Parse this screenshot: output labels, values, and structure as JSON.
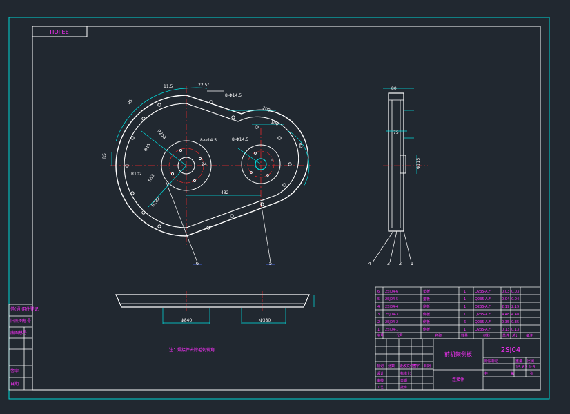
{
  "colors": {
    "background": "#212830",
    "frame": "#00d6d6",
    "geometry": "#ffffff",
    "dimension": "#00e5e5",
    "centerline": "#ff2a2a",
    "text_magenta": "#ff30ff",
    "leader_blue": "#4a6cff"
  },
  "drawing": {
    "top_left_tag": "ПОГЕЕ",
    "code": "2SJ04",
    "part_name": "前机架侧板",
    "note": "注：焊接件去除毛刺锐角",
    "dimensions": {
      "d0": "11.5",
      "d1": "22.5°",
      "d2": "R5",
      "d3": "8-Φ14.5",
      "d4": "200",
      "d5": "100",
      "d6": "R2",
      "d7": "R5",
      "d8": "R253",
      "d9": "Φ15",
      "d10": "R102",
      "d11": "R282",
      "d12": "432",
      "d13": "8-Φ14.5",
      "d14": "8-Φ14.5",
      "d15": "24",
      "d16": "R53",
      "d17": "Φ840",
      "d18": "Φ380",
      "d19": "75",
      "d20": "Φ115",
      "d21": "80"
    },
    "balloons_front": [
      "6",
      "5"
    ],
    "balloons_side": [
      "4",
      "3",
      "2",
      "1"
    ],
    "bom_rows": [
      {
        "no": "6",
        "code": "2SJ04-6",
        "name": "垫板",
        "qty": "1",
        "material": "Q235-A.F",
        "unit": "0.03",
        "total": "0.03"
      },
      {
        "no": "5",
        "code": "2SJ04-5",
        "name": "垫板",
        "qty": "1",
        "material": "Q235-A.F",
        "unit": "0.04",
        "total": "0.04"
      },
      {
        "no": "4",
        "code": "2SJ04-4",
        "name": "侧板",
        "qty": "1",
        "material": "Q235-A.F",
        "unit": "2.19",
        "total": "2.19"
      },
      {
        "no": "3",
        "code": "2SJ04-3",
        "name": "侧板",
        "qty": "1",
        "material": "Q235-A.F",
        "unit": "4.48",
        "total": "4.48"
      },
      {
        "no": "2",
        "code": "2SJ04-2",
        "name": "侧板",
        "qty": "6",
        "material": "Q235-A.F",
        "unit": "0.35",
        "total": "0.35"
      },
      {
        "no": "1",
        "code": "2SJ04-1",
        "name": "侧板",
        "qty": "1",
        "material": "Q235-A.F",
        "unit": "0.13",
        "total": "0.13"
      }
    ],
    "bom_header": [
      "序号",
      "代号",
      "名称",
      "数量",
      "材料",
      "单件",
      "总计",
      "备注"
    ],
    "title_block": {
      "weight": "15.82",
      "scale": "1:5",
      "sheet_label": "共",
      "sheet_of": "第",
      "sheet_of_2": "张",
      "left_labels": [
        "设计",
        "审核",
        "工艺",
        "标准化",
        "批准"
      ],
      "date_label": "日期",
      "grid_labels": [
        "标记",
        "处数",
        "更改文件号",
        "签字",
        "日期"
      ],
      "stage_label": "阶段标记",
      "weight_label": "重量",
      "scale_label": "比例",
      "company": "连接件"
    },
    "left_strip": [
      "借(通)用件登记",
      "旧底图总号",
      "底图总号",
      "签字",
      "日期"
    ]
  }
}
